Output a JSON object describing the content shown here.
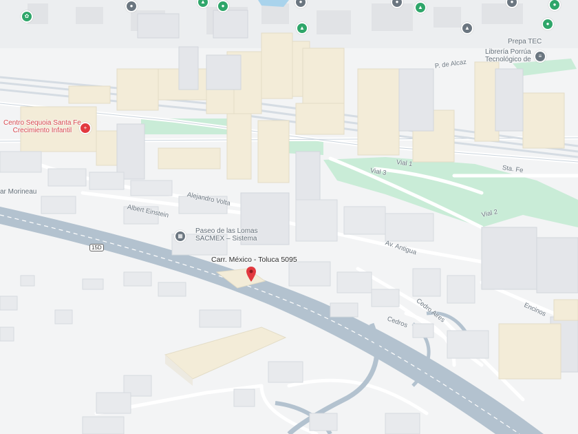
{
  "map": {
    "marker_label": "Carr. México - Toluca 5095",
    "places": [
      {
        "name": "Centro Sequoia Santa Fe\nCrecimiento Infantil",
        "kind": "red"
      },
      {
        "name": "Paseo de las Lomas\nSACMEX – Sistema",
        "kind": "gray"
      },
      {
        "name": "Prepa TEC",
        "kind": "gray"
      },
      {
        "name": "Librería Porrúa\nTecnológico de",
        "kind": "gray"
      },
      {
        "name": "ar Morineau",
        "kind": "gray"
      }
    ],
    "roads": [
      "Alejandro Volta",
      "Albert Einstein",
      "Av. Antigua",
      "P. de Alcaz",
      "Vial 3",
      "Vial 1",
      "Sta. Fe",
      "Vial 2",
      "Cedros",
      "Encinos",
      "Cedro Aires"
    ],
    "highway_shield": "15D",
    "colors": {
      "background": "#f3f4f5",
      "park": "#c9ecd7",
      "building_beige": "#f3ecd8",
      "building_gray": "#e4e6ea",
      "highway": "#b3c2cf",
      "marker": "#e2393f",
      "poi_green": "#2fa66a",
      "poi_gray": "#6b7680",
      "poi_red": "#e2393f"
    }
  }
}
